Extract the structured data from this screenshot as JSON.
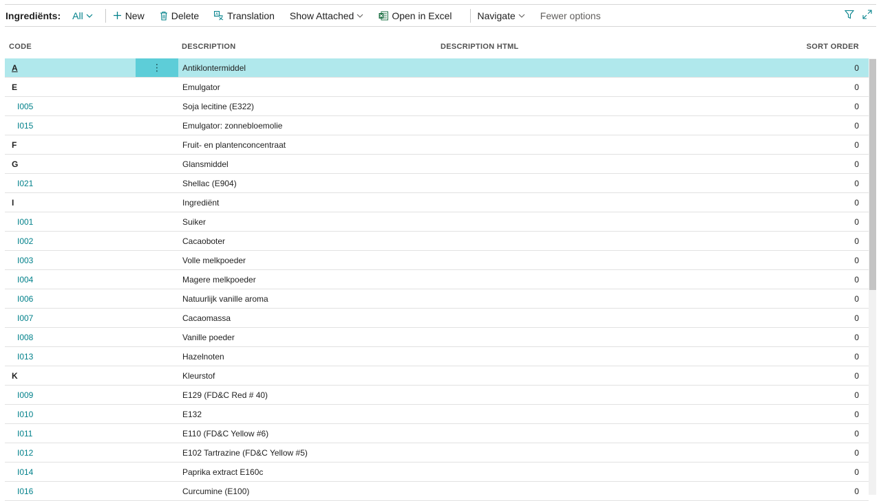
{
  "toolbar": {
    "title": "Ingrediënts:",
    "filter": "All",
    "new_label": "New",
    "delete_label": "Delete",
    "translation_label": "Translation",
    "show_attached_label": "Show Attached",
    "open_in_excel_label": "Open in Excel",
    "navigate_label": "Navigate",
    "fewer_options_label": "Fewer options"
  },
  "columns": {
    "code": "CODE",
    "description": "DESCRIPTION",
    "description_html": "DESCRIPTION HTML",
    "sort_order": "SORT ORDER"
  },
  "rows": [
    {
      "code": "A",
      "description": "Antiklontermiddel",
      "sort_order": "0",
      "group": true,
      "selected": true
    },
    {
      "code": "E",
      "description": "Emulgator",
      "sort_order": "0",
      "group": true
    },
    {
      "code": "I005",
      "description": "Soja lecitine (E322)",
      "sort_order": "0"
    },
    {
      "code": "I015",
      "description": "Emulgator: zonnebloemolie",
      "sort_order": "0"
    },
    {
      "code": "F",
      "description": "Fruit- en plantenconcentraat",
      "sort_order": "0",
      "group": true
    },
    {
      "code": "G",
      "description": "Glansmiddel",
      "sort_order": "0",
      "group": true
    },
    {
      "code": "I021",
      "description": "Shellac (E904)",
      "sort_order": "0"
    },
    {
      "code": "I",
      "description": "Ingrediënt",
      "sort_order": "0",
      "group": true
    },
    {
      "code": "I001",
      "description": "Suiker",
      "sort_order": "0"
    },
    {
      "code": "I002",
      "description": "Cacaoboter",
      "sort_order": "0"
    },
    {
      "code": "I003",
      "description": "Volle melkpoeder",
      "sort_order": "0"
    },
    {
      "code": "I004",
      "description": "Magere melkpoeder",
      "sort_order": "0"
    },
    {
      "code": "I006",
      "description": "Natuurlijk vanille aroma",
      "sort_order": "0"
    },
    {
      "code": "I007",
      "description": "Cacaomassa",
      "sort_order": "0"
    },
    {
      "code": "I008",
      "description": "Vanille poeder",
      "sort_order": "0"
    },
    {
      "code": "I013",
      "description": "Hazelnoten",
      "sort_order": "0"
    },
    {
      "code": "K",
      "description": "Kleurstof",
      "sort_order": "0",
      "group": true
    },
    {
      "code": "I009",
      "description": "E129 (FD&C Red # 40)",
      "sort_order": "0"
    },
    {
      "code": "I010",
      "description": "E132",
      "sort_order": "0"
    },
    {
      "code": "I011",
      "description": "E110 (FD&C Yellow #6)",
      "sort_order": "0"
    },
    {
      "code": "I012",
      "description": "E102 Tartrazine (FD&C Yellow #5)",
      "sort_order": "0"
    },
    {
      "code": "I014",
      "description": "Paprika extract E160c",
      "sort_order": "0"
    },
    {
      "code": "I016",
      "description": "Curcumine (E100)",
      "sort_order": "0"
    }
  ],
  "colors": {
    "accent": "#00808a",
    "selected_row": "#b0e8ec",
    "row_menu": "#5dcdd8"
  },
  "icons": [
    "plus-icon",
    "trash-icon",
    "translation-icon",
    "excel-icon",
    "chevron-down-icon",
    "filter-icon",
    "expand-icon",
    "more-vertical-icon"
  ]
}
